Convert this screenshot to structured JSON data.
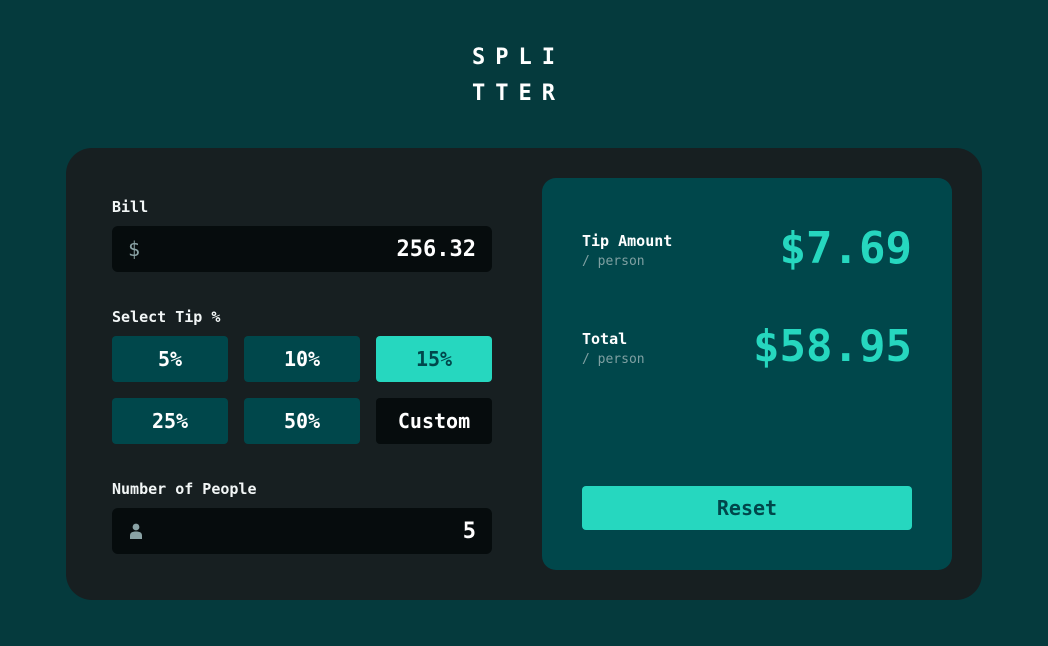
{
  "app": {
    "logo_line1": "SPLI",
    "logo_line2": "TTER"
  },
  "form": {
    "bill_label": "Bill",
    "bill_prefix": "$",
    "bill_value": "256.32",
    "tip_label": "Select Tip %",
    "tips": [
      {
        "label": "5%",
        "selected": false
      },
      {
        "label": "10%",
        "selected": false
      },
      {
        "label": "15%",
        "selected": true
      },
      {
        "label": "25%",
        "selected": false
      },
      {
        "label": "50%",
        "selected": false
      }
    ],
    "custom_label": "Custom",
    "people_label": "Number of People",
    "people_value": "5",
    "people_icon": "person-icon"
  },
  "results": {
    "tip_title": "Tip Amount",
    "tip_sub": "/ person",
    "tip_amount": "$7.69",
    "total_title": "Total",
    "total_sub": "/ person",
    "total_amount": "$58.95",
    "reset_label": "Reset"
  },
  "colors": {
    "background": "#053a3d",
    "card": "#171f21",
    "results_panel": "#00474b",
    "accent": "#26d7bf",
    "input_bg": "#060c0d"
  }
}
